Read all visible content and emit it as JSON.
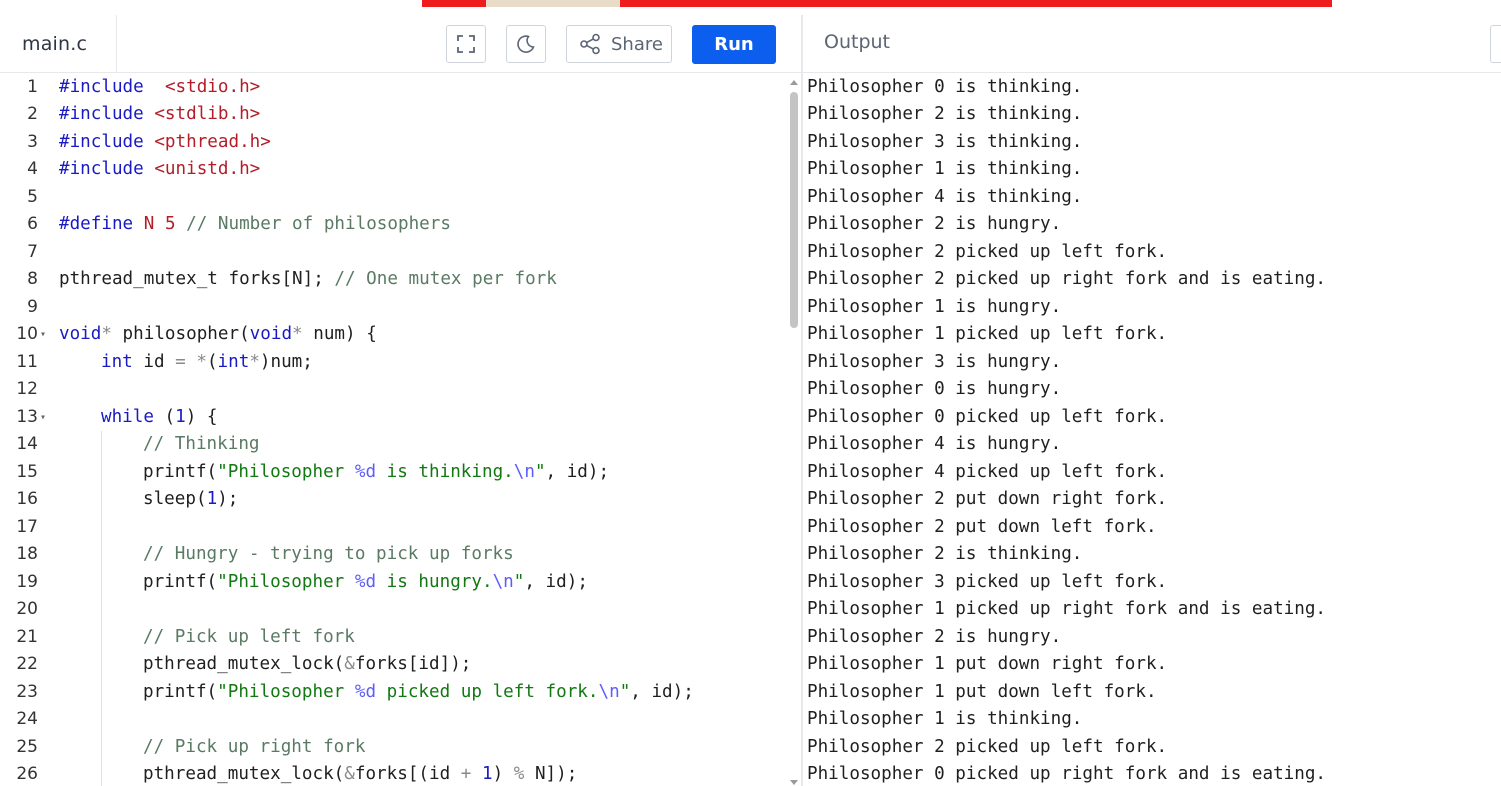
{
  "editor": {
    "file_name": "main.c",
    "share_label": "Share",
    "run_label": "Run"
  },
  "output": {
    "title": "Output",
    "lines": [
      "Philosopher 0 is thinking.",
      "Philosopher 2 is thinking.",
      "Philosopher 3 is thinking.",
      "Philosopher 1 is thinking.",
      "Philosopher 4 is thinking.",
      "Philosopher 2 is hungry.",
      "Philosopher 2 picked up left fork.",
      "Philosopher 2 picked up right fork and is eating.",
      "Philosopher 1 is hungry.",
      "Philosopher 1 picked up left fork.",
      "Philosopher 3 is hungry.",
      "Philosopher 0 is hungry.",
      "Philosopher 0 picked up left fork.",
      "Philosopher 4 is hungry.",
      "Philosopher 4 picked up left fork.",
      "Philosopher 2 put down right fork.",
      "Philosopher 2 put down left fork.",
      "Philosopher 2 is thinking.",
      "Philosopher 3 picked up left fork.",
      "Philosopher 1 picked up right fork and is eating.",
      "Philosopher 2 is hungry.",
      "Philosopher 1 put down right fork.",
      "Philosopher 1 put down left fork.",
      "Philosopher 1 is thinking.",
      "Philosopher 2 picked up left fork.",
      "Philosopher 0 picked up right fork and is eating."
    ]
  },
  "code": {
    "lines": [
      {
        "n": "1",
        "fold": false,
        "indent": 0,
        "tokens": [
          [
            "pp",
            "#include"
          ],
          [
            "",
            "  "
          ],
          [
            "inc",
            "<stdio.h>"
          ]
        ]
      },
      {
        "n": "2",
        "fold": false,
        "indent": 0,
        "tokens": [
          [
            "pp",
            "#include"
          ],
          [
            "",
            ""
          ],
          [
            "inc",
            " <stdlib.h>"
          ]
        ]
      },
      {
        "n": "3",
        "fold": false,
        "indent": 0,
        "tokens": [
          [
            "pp",
            "#include"
          ],
          [
            "inc",
            " <pthread.h>"
          ]
        ]
      },
      {
        "n": "4",
        "fold": false,
        "indent": 0,
        "tokens": [
          [
            "pp",
            "#include"
          ],
          [
            "inc",
            " <unistd.h>"
          ]
        ]
      },
      {
        "n": "5",
        "fold": false,
        "indent": 0,
        "tokens": []
      },
      {
        "n": "6",
        "fold": false,
        "indent": 0,
        "tokens": [
          [
            "pp",
            "#define"
          ],
          [
            "",
            " "
          ],
          [
            "macro",
            "N"
          ],
          [
            "",
            " "
          ],
          [
            "macro",
            "5"
          ],
          [
            "",
            " "
          ],
          [
            "cmt",
            "// Number of philosophers"
          ]
        ]
      },
      {
        "n": "7",
        "fold": false,
        "indent": 0,
        "tokens": []
      },
      {
        "n": "8",
        "fold": false,
        "indent": 0,
        "tokens": [
          [
            "",
            "pthread_mutex_t forks[N]; "
          ],
          [
            "cmt",
            "// One mutex per fork"
          ]
        ]
      },
      {
        "n": "9",
        "fold": false,
        "indent": 0,
        "tokens": []
      },
      {
        "n": "10",
        "fold": true,
        "indent": 0,
        "tokens": [
          [
            "kw",
            "void"
          ],
          [
            "op",
            "*"
          ],
          [
            "",
            " philosopher("
          ],
          [
            "kw",
            "void"
          ],
          [
            "op",
            "*"
          ],
          [
            "",
            " num) {"
          ]
        ]
      },
      {
        "n": "11",
        "fold": false,
        "indent": 1,
        "tokens": [
          [
            "kw",
            "int"
          ],
          [
            "",
            " id "
          ],
          [
            "op",
            "="
          ],
          [
            "",
            " "
          ],
          [
            "op",
            "*"
          ],
          [
            "",
            "("
          ],
          [
            "kw",
            "int"
          ],
          [
            "op",
            "*"
          ],
          [
            "",
            ")num;"
          ]
        ]
      },
      {
        "n": "12",
        "fold": false,
        "indent": 0,
        "tokens": []
      },
      {
        "n": "13",
        "fold": true,
        "indent": 1,
        "tokens": [
          [
            "kw",
            "while"
          ],
          [
            "",
            " ("
          ],
          [
            "num",
            "1"
          ],
          [
            "",
            ") {"
          ]
        ]
      },
      {
        "n": "14",
        "fold": false,
        "indent": 2,
        "tokens": [
          [
            "cmt",
            "// Thinking"
          ]
        ]
      },
      {
        "n": "15",
        "fold": false,
        "indent": 2,
        "tokens": [
          [
            "",
            "printf("
          ],
          [
            "str",
            "\"Philosopher "
          ],
          [
            "esc",
            "%d"
          ],
          [
            "str",
            " is thinking."
          ],
          [
            "esc",
            "\\n"
          ],
          [
            "str",
            "\""
          ],
          [
            "",
            ", id);"
          ]
        ]
      },
      {
        "n": "16",
        "fold": false,
        "indent": 2,
        "tokens": [
          [
            "",
            "sleep("
          ],
          [
            "num",
            "1"
          ],
          [
            "",
            ");"
          ]
        ]
      },
      {
        "n": "17",
        "fold": false,
        "indent": 0,
        "tokens": []
      },
      {
        "n": "18",
        "fold": false,
        "indent": 2,
        "tokens": [
          [
            "cmt",
            "// Hungry - trying to pick up forks"
          ]
        ]
      },
      {
        "n": "19",
        "fold": false,
        "indent": 2,
        "tokens": [
          [
            "",
            "printf("
          ],
          [
            "str",
            "\"Philosopher "
          ],
          [
            "esc",
            "%d"
          ],
          [
            "str",
            " is hungry."
          ],
          [
            "esc",
            "\\n"
          ],
          [
            "str",
            "\""
          ],
          [
            "",
            ", id);"
          ]
        ]
      },
      {
        "n": "20",
        "fold": false,
        "indent": 0,
        "tokens": []
      },
      {
        "n": "21",
        "fold": false,
        "indent": 2,
        "tokens": [
          [
            "cmt",
            "// Pick up left fork"
          ]
        ]
      },
      {
        "n": "22",
        "fold": false,
        "indent": 2,
        "tokens": [
          [
            "",
            "pthread_mutex_lock("
          ],
          [
            "op",
            "&"
          ],
          [
            "",
            "forks[id]);"
          ]
        ]
      },
      {
        "n": "23",
        "fold": false,
        "indent": 2,
        "tokens": [
          [
            "",
            "printf("
          ],
          [
            "str",
            "\"Philosopher "
          ],
          [
            "esc",
            "%d"
          ],
          [
            "str",
            " picked up left fork."
          ],
          [
            "esc",
            "\\n"
          ],
          [
            "str",
            "\""
          ],
          [
            "",
            ", id);"
          ]
        ]
      },
      {
        "n": "24",
        "fold": false,
        "indent": 0,
        "tokens": []
      },
      {
        "n": "25",
        "fold": false,
        "indent": 2,
        "tokens": [
          [
            "cmt",
            "// Pick up right fork"
          ]
        ]
      },
      {
        "n": "26",
        "fold": false,
        "indent": 2,
        "tokens": [
          [
            "",
            "pthread_mutex_lock("
          ],
          [
            "op",
            "&"
          ],
          [
            "",
            "forks[(id "
          ],
          [
            "op",
            "+"
          ],
          [
            "",
            " "
          ],
          [
            "num",
            "1"
          ],
          [
            "",
            ") "
          ],
          [
            "op",
            "%"
          ],
          [
            "",
            " N]);"
          ]
        ]
      }
    ]
  }
}
